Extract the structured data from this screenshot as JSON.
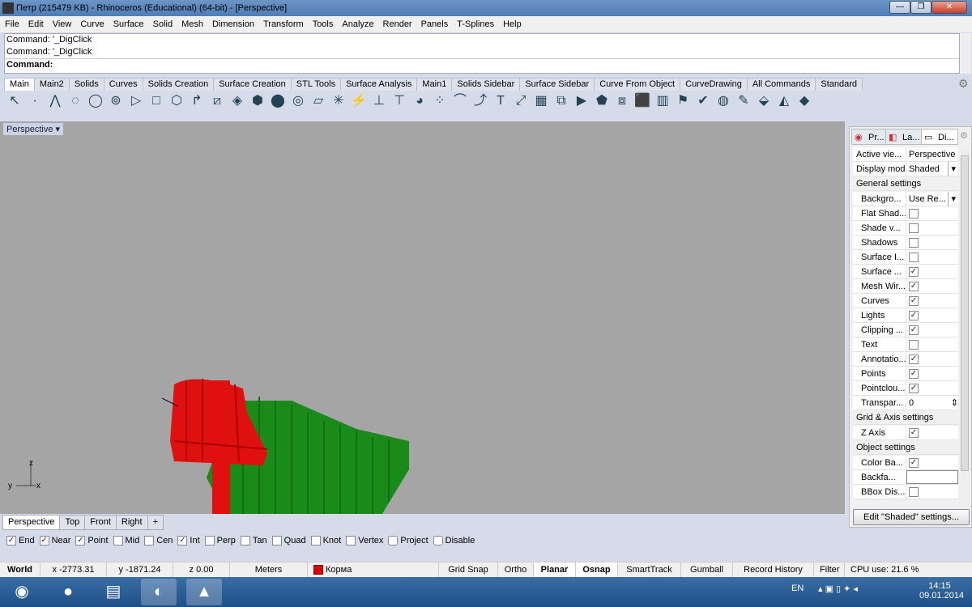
{
  "window": {
    "title": "Петр (215479 KB) - Rhinoceros (Educational) (64-bit) - [Perspective]"
  },
  "menu": [
    "File",
    "Edit",
    "View",
    "Curve",
    "Surface",
    "Solid",
    "Mesh",
    "Dimension",
    "Transform",
    "Tools",
    "Analyze",
    "Render",
    "Panels",
    "T-Splines",
    "Help"
  ],
  "command": {
    "history": [
      "Command: '_DigClick",
      "Command: '_DigClick"
    ],
    "prompt": "Command:"
  },
  "toolbar_tabs": [
    "Main",
    "Main2",
    "Solids",
    "Curves",
    "Solids Creation",
    "Surface Creation",
    "STL Tools",
    "Surface Analysis",
    "Main1",
    "Solids Sidebar",
    "Surface Sidebar",
    "Curve From Object",
    "CurveDrawing",
    "All Commands",
    "Standard"
  ],
  "toolbar_icons": [
    "select-arrow",
    "point",
    "polyline",
    "curve",
    "circle",
    "ellipse",
    "arc",
    "rectangle",
    "polygon",
    "fillet",
    "surface",
    "extrude",
    "box",
    "sphere",
    "cylinder",
    "plane",
    "explode",
    "boolean",
    "trim",
    "split",
    "group",
    "layer",
    "rotate",
    "move",
    "text",
    "scale",
    "array",
    "mirror",
    "join",
    "properties",
    "check",
    "render",
    "history",
    "analyze",
    "paint",
    "lock",
    "display",
    "object",
    "camera",
    "light"
  ],
  "viewport": {
    "title": "Perspective",
    "axes": [
      "z",
      "y",
      "x"
    ]
  },
  "viewport_tabs": [
    "Perspective",
    "Top",
    "Front",
    "Right",
    "+"
  ],
  "osnap": [
    {
      "label": "End",
      "checked": true
    },
    {
      "label": "Near",
      "checked": true
    },
    {
      "label": "Point",
      "checked": true
    },
    {
      "label": "Mid",
      "checked": false
    },
    {
      "label": "Cen",
      "checked": false
    },
    {
      "label": "Int",
      "checked": true
    },
    {
      "label": "Perp",
      "checked": false
    },
    {
      "label": "Tan",
      "checked": false
    },
    {
      "label": "Quad",
      "checked": false
    },
    {
      "label": "Knot",
      "checked": false
    },
    {
      "label": "Vertex",
      "checked": false
    },
    {
      "label": "Project",
      "checked": false
    },
    {
      "label": "Disable",
      "checked": false
    }
  ],
  "status": {
    "world": "World",
    "x": "x -2773.31",
    "y": "y -1871.24",
    "z": "z 0.00",
    "units": "Meters",
    "layer": "Корма",
    "layer_color": "#e00000",
    "grid_snap": "Grid Snap",
    "ortho": "Ortho",
    "planar": "Planar",
    "osnap": "Osnap",
    "smarttrack": "SmartTrack",
    "gumball": "Gumball",
    "record_history": "Record History",
    "filter": "Filter",
    "cpu": "CPU use: 21.6 %"
  },
  "panel": {
    "tabs": [
      "Pr...",
      "La...",
      "Di..."
    ],
    "rows": [
      {
        "k": "Active vie...",
        "v": "Perspective"
      },
      {
        "k": "Display mode",
        "v": "Shaded",
        "dropdown": true
      },
      {
        "section": "General settings"
      },
      {
        "k": "Backgro...",
        "v": "Use Re...",
        "dropdown": true
      },
      {
        "k": "Flat Shad...",
        "check": false
      },
      {
        "k": "Shade v...",
        "check": false
      },
      {
        "k": "Shadows",
        "check": false
      },
      {
        "k": "Surface I...",
        "check": false
      },
      {
        "k": "Surface ...",
        "check": true
      },
      {
        "k": "Mesh Wir...",
        "check": true
      },
      {
        "k": "Curves",
        "check": true
      },
      {
        "k": "Lights",
        "check": true
      },
      {
        "k": "Clipping ...",
        "check": true
      },
      {
        "k": "Text",
        "check": false
      },
      {
        "k": "Annotatio...",
        "check": true
      },
      {
        "k": "Points",
        "check": true
      },
      {
        "k": "Pointclou...",
        "check": true
      },
      {
        "k": "Transpar...",
        "v": "0"
      },
      {
        "section": "Grid & Axis settings"
      },
      {
        "k": "Z Axis",
        "check": true
      },
      {
        "section": "Object settings"
      },
      {
        "k": "Color Ba...",
        "check": true
      },
      {
        "k": "Backfa...",
        "v": ""
      },
      {
        "k": "BBox Dis...",
        "check": false
      }
    ],
    "edit_button": "Edit \"Shaded\" settings..."
  },
  "taskbar": {
    "lang": "EN",
    "time": "14:15",
    "date": "09.01.2014",
    "apps": [
      "start",
      "chrome",
      "explorer",
      "media",
      "rhino"
    ]
  }
}
